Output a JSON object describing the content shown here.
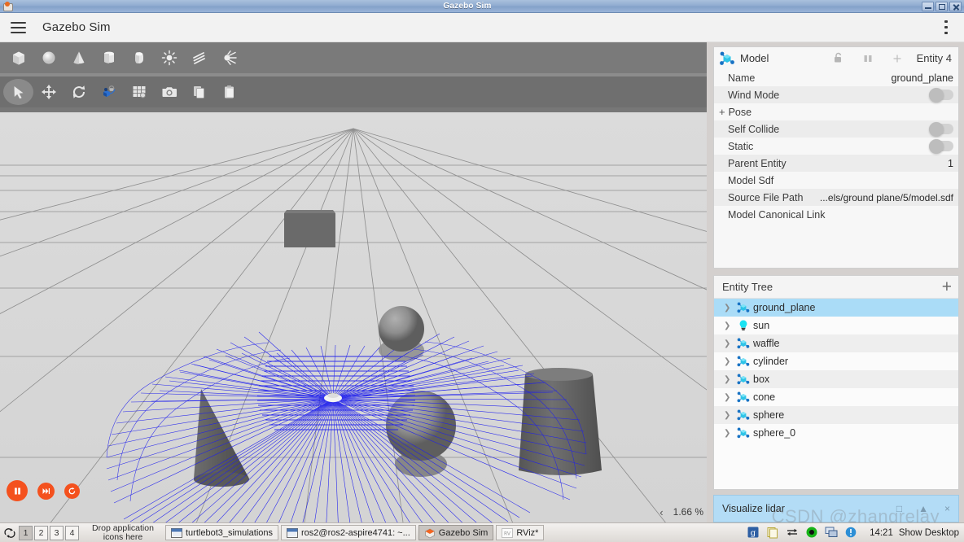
{
  "window": {
    "title": "Gazebo Sim",
    "icon": "gazebo-logo-icon",
    "buttons": {
      "minimize": "minimize",
      "maximize": "maximize",
      "close": "close"
    }
  },
  "header": {
    "menu_icon": "hamburger-icon",
    "app_title": "Gazebo Sim",
    "overflow_icon": "kebab-menu-icon"
  },
  "toolbar": {
    "shapes": [
      {
        "name": "box-shape-icon",
        "label": "Box"
      },
      {
        "name": "sphere-shape-icon",
        "label": "Sphere"
      },
      {
        "name": "cone-shape-icon",
        "label": "Cone"
      },
      {
        "name": "cylinder-shape-icon",
        "label": "Cylinder"
      },
      {
        "name": "capsule-shape-icon",
        "label": "Capsule"
      },
      {
        "name": "point-light-icon",
        "label": "Point Light"
      },
      {
        "name": "directional-light-icon",
        "label": "Directional Light"
      },
      {
        "name": "spot-light-icon",
        "label": "Spot Light"
      }
    ],
    "tools": [
      {
        "name": "select-arrow-icon",
        "label": "Select",
        "active": true
      },
      {
        "name": "translate-icon",
        "label": "Translate",
        "active": false
      },
      {
        "name": "rotate-icon",
        "label": "Rotate",
        "active": false
      },
      {
        "name": "transform-control-icon",
        "label": "Transform Control",
        "active": false
      },
      {
        "name": "grid-icon",
        "label": "Grid",
        "active": false
      },
      {
        "name": "screenshot-camera-icon",
        "label": "Screenshot",
        "active": false
      },
      {
        "name": "copy-icon",
        "label": "Copy",
        "active": false
      },
      {
        "name": "paste-icon",
        "label": "Paste",
        "active": false
      }
    ]
  },
  "viewport": {
    "playback": [
      {
        "name": "pause-button",
        "icon": "pause-icon"
      },
      {
        "name": "step-forward-button",
        "icon": "step-forward-icon"
      },
      {
        "name": "reset-button",
        "icon": "reset-icon"
      }
    ],
    "collapse_icon": "chevron-left-icon",
    "rtf_value": "1.66 %",
    "scene": {
      "grid": true,
      "background": "#d9d9d9",
      "lidar_color": "#1f1fee",
      "objects": [
        "waffle",
        "cone",
        "box",
        "sphere",
        "sphere_0",
        "cylinder",
        "ground_plane"
      ]
    }
  },
  "model_panel": {
    "icon": "model-node-icon",
    "title": "Model",
    "lock_icon": "unlock-icon",
    "pause_icon": "pause-columns-icon",
    "add_icon": "plus-icon",
    "entity_label": "Entity 4",
    "properties": [
      {
        "label": "Name",
        "value": "ground_plane",
        "type": "text"
      },
      {
        "label": "Wind Mode",
        "value": "",
        "type": "toggle"
      },
      {
        "label": "Pose",
        "value": "",
        "type": "expander"
      },
      {
        "label": "Self Collide",
        "value": "",
        "type": "toggle"
      },
      {
        "label": "Static",
        "value": "",
        "type": "toggle"
      },
      {
        "label": "Parent Entity",
        "value": "1",
        "type": "text"
      },
      {
        "label": "Model Sdf",
        "value": "",
        "type": "text"
      },
      {
        "label": "Source File Path",
        "value": "...els/ground plane/5/model.sdf",
        "type": "text"
      },
      {
        "label": "Model Canonical Link",
        "value": "",
        "type": "text"
      }
    ]
  },
  "entity_tree": {
    "title": "Entity Tree",
    "add_icon": "plus-icon",
    "items": [
      {
        "label": "ground_plane",
        "icon": "model-node-icon",
        "selected": true
      },
      {
        "label": "sun",
        "icon": "light-bulb-icon",
        "selected": false
      },
      {
        "label": "waffle",
        "icon": "model-node-icon",
        "selected": false
      },
      {
        "label": "cylinder",
        "icon": "model-node-icon",
        "selected": false
      },
      {
        "label": "box",
        "icon": "model-node-icon",
        "selected": false
      },
      {
        "label": "cone",
        "icon": "model-node-icon",
        "selected": false
      },
      {
        "label": "sphere",
        "icon": "model-node-icon",
        "selected": false
      },
      {
        "label": "sphere_0",
        "icon": "model-node-icon",
        "selected": false
      }
    ]
  },
  "lidar_panel": {
    "title": "Visualize lidar",
    "controls": [
      {
        "name": "float-button",
        "glyph": "□"
      },
      {
        "name": "collapse-button",
        "glyph": "▲"
      },
      {
        "name": "close-button",
        "glyph": "×"
      }
    ]
  },
  "taskbar": {
    "refresh_icon": "workspace-switch-icon",
    "workspaces": [
      {
        "label": "1",
        "active": true
      },
      {
        "label": "2",
        "active": false
      },
      {
        "label": "3",
        "active": false
      },
      {
        "label": "4",
        "active": false
      }
    ],
    "drop_zone": "Drop application icons here",
    "tasks": [
      {
        "label": "turtlebot3_simulations",
        "icon": "terminal-window-icon",
        "active": false
      },
      {
        "label": "ros2@ros2-aspire4741: ~...",
        "icon": "terminal-window-icon",
        "active": false
      },
      {
        "label": "Gazebo Sim",
        "icon": "gazebo-logo-icon",
        "active": true
      },
      {
        "label": "RViz*",
        "icon": "rviz-icon",
        "active": false
      }
    ],
    "tray": [
      {
        "name": "gedit-tray-icon"
      },
      {
        "name": "clipboard-tray-icon"
      },
      {
        "name": "network-transfer-tray-icon"
      },
      {
        "name": "record-tray-icon"
      },
      {
        "name": "remote-desktop-tray-icon"
      },
      {
        "name": "updates-tray-icon"
      }
    ],
    "clock": "14:21",
    "show_desktop": "Show Desktop"
  },
  "watermark": "CSDN @zhangrelay"
}
